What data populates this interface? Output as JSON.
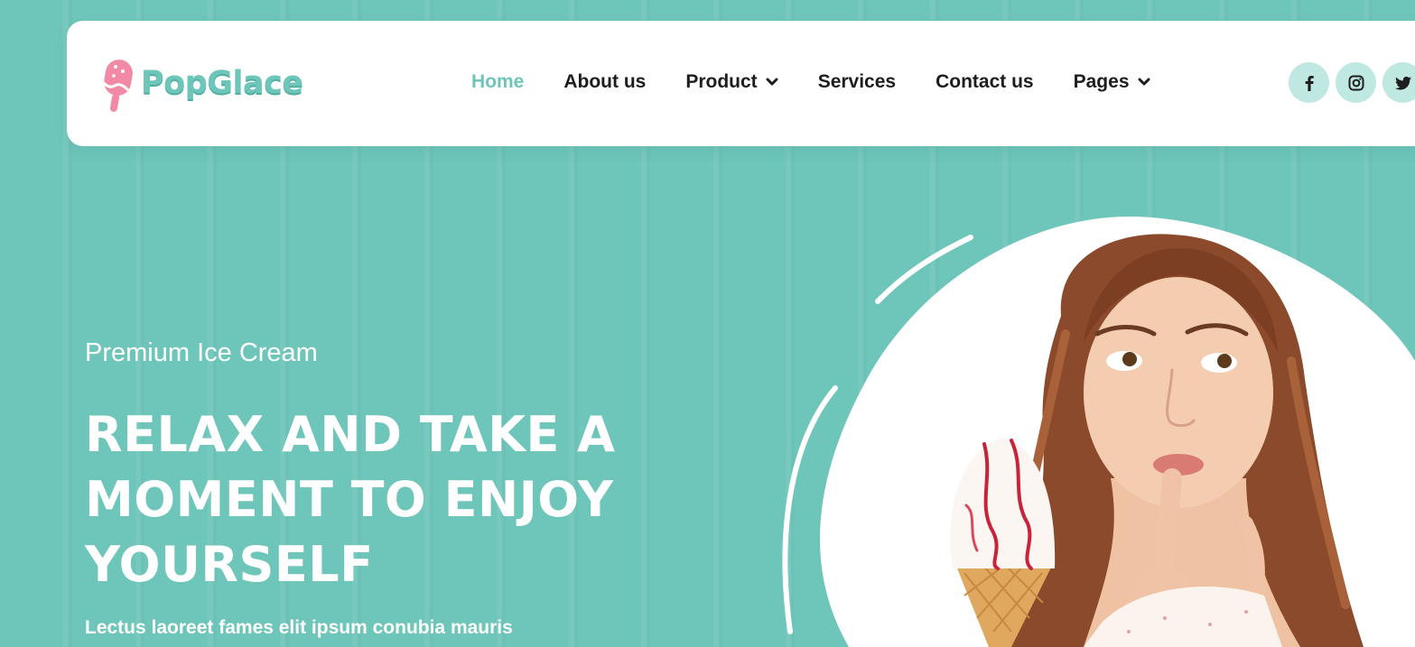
{
  "brand": {
    "name": "PopGlace",
    "logo_icon": "popsicle-icon"
  },
  "nav": {
    "items": [
      {
        "label": "Home",
        "active": true
      },
      {
        "label": "About us"
      },
      {
        "label": "Product",
        "has_dropdown": true
      },
      {
        "label": "Services"
      },
      {
        "label": "Contact us"
      },
      {
        "label": "Pages",
        "has_dropdown": true
      }
    ]
  },
  "social": [
    "facebook-icon",
    "instagram-icon",
    "twitter-icon"
  ],
  "hero": {
    "eyebrow": "Premium Ice Cream",
    "headline": "RELAX AND TAKE A MOMENT TO ENJOY YOURSELF",
    "lead": "Lectus laoreet fames elit ipsum conubia mauris",
    "image": "woman-with-ice-cream-cone"
  },
  "colors": {
    "accent": "#6ec6ba",
    "accent_light": "#bfe8e2",
    "logo_pink": "#f28aa5",
    "text_dark": "#1d1d1d",
    "white": "#ffffff"
  }
}
